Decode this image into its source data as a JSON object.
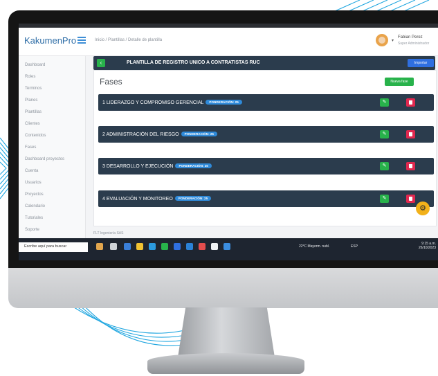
{
  "app": {
    "logo": "KakumenPro",
    "breadcrumb": "Inicio  /  Plantillas  /  Detalle de plantilla"
  },
  "user": {
    "name": "Fabian Perez",
    "role": "Super Administrador"
  },
  "sidebar": {
    "items": [
      {
        "label": "Dashboard"
      },
      {
        "label": "Roles"
      },
      {
        "label": "Terminos"
      },
      {
        "label": "Planes"
      },
      {
        "label": "Plantillas"
      },
      {
        "label": "Clientes"
      },
      {
        "label": "Contenidos"
      },
      {
        "label": "Fases"
      },
      {
        "label": "Dashboard proyectos"
      },
      {
        "label": "Cuenta"
      },
      {
        "label": "Usuarios"
      },
      {
        "label": "Proyectos"
      },
      {
        "label": "Calendario"
      },
      {
        "label": "Tutoriales"
      },
      {
        "label": "Soporte"
      }
    ]
  },
  "header": {
    "back_icon": "‹",
    "title": "PLANTILLA DE REGISTRO UNICO A CONTRATISTAS RUC",
    "import_label": "Importar"
  },
  "fases": {
    "title": "Fases",
    "new_label": "Nueva fase",
    "items": [
      {
        "name": "1 LIDERAZGO Y COMPROMISO GERENCIAL",
        "badge": "PONDERACIÓN: 25"
      },
      {
        "name": "2 ADMINISTRACIÓN DEL RIESGO",
        "badge": "PONDERACIÓN: 25"
      },
      {
        "name": "3 DESARROLLO Y EJECUCIÓN",
        "badge": "PONDERACIÓN: 25"
      },
      {
        "name": "4 EVALUACIÓN Y MONITOREO",
        "badge": "PONDERACIÓN: 25"
      }
    ]
  },
  "footer": {
    "text": "FLT Ingeniería SAS"
  },
  "taskbar": {
    "search_placeholder": "Escribe aquí para buscar",
    "weather": "22°C  Mayorm. nubl.",
    "tray": "ESP",
    "time": "9:15 a.m.",
    "date": "26/10/2023"
  },
  "colors": {
    "header_bg": "#2b3c4d",
    "accent_green": "#28b24b",
    "accent_red": "#e0284f",
    "accent_blue": "#2f6fe0",
    "badge_blue": "#2f8ad9",
    "fab_yellow": "#f2b11a"
  }
}
